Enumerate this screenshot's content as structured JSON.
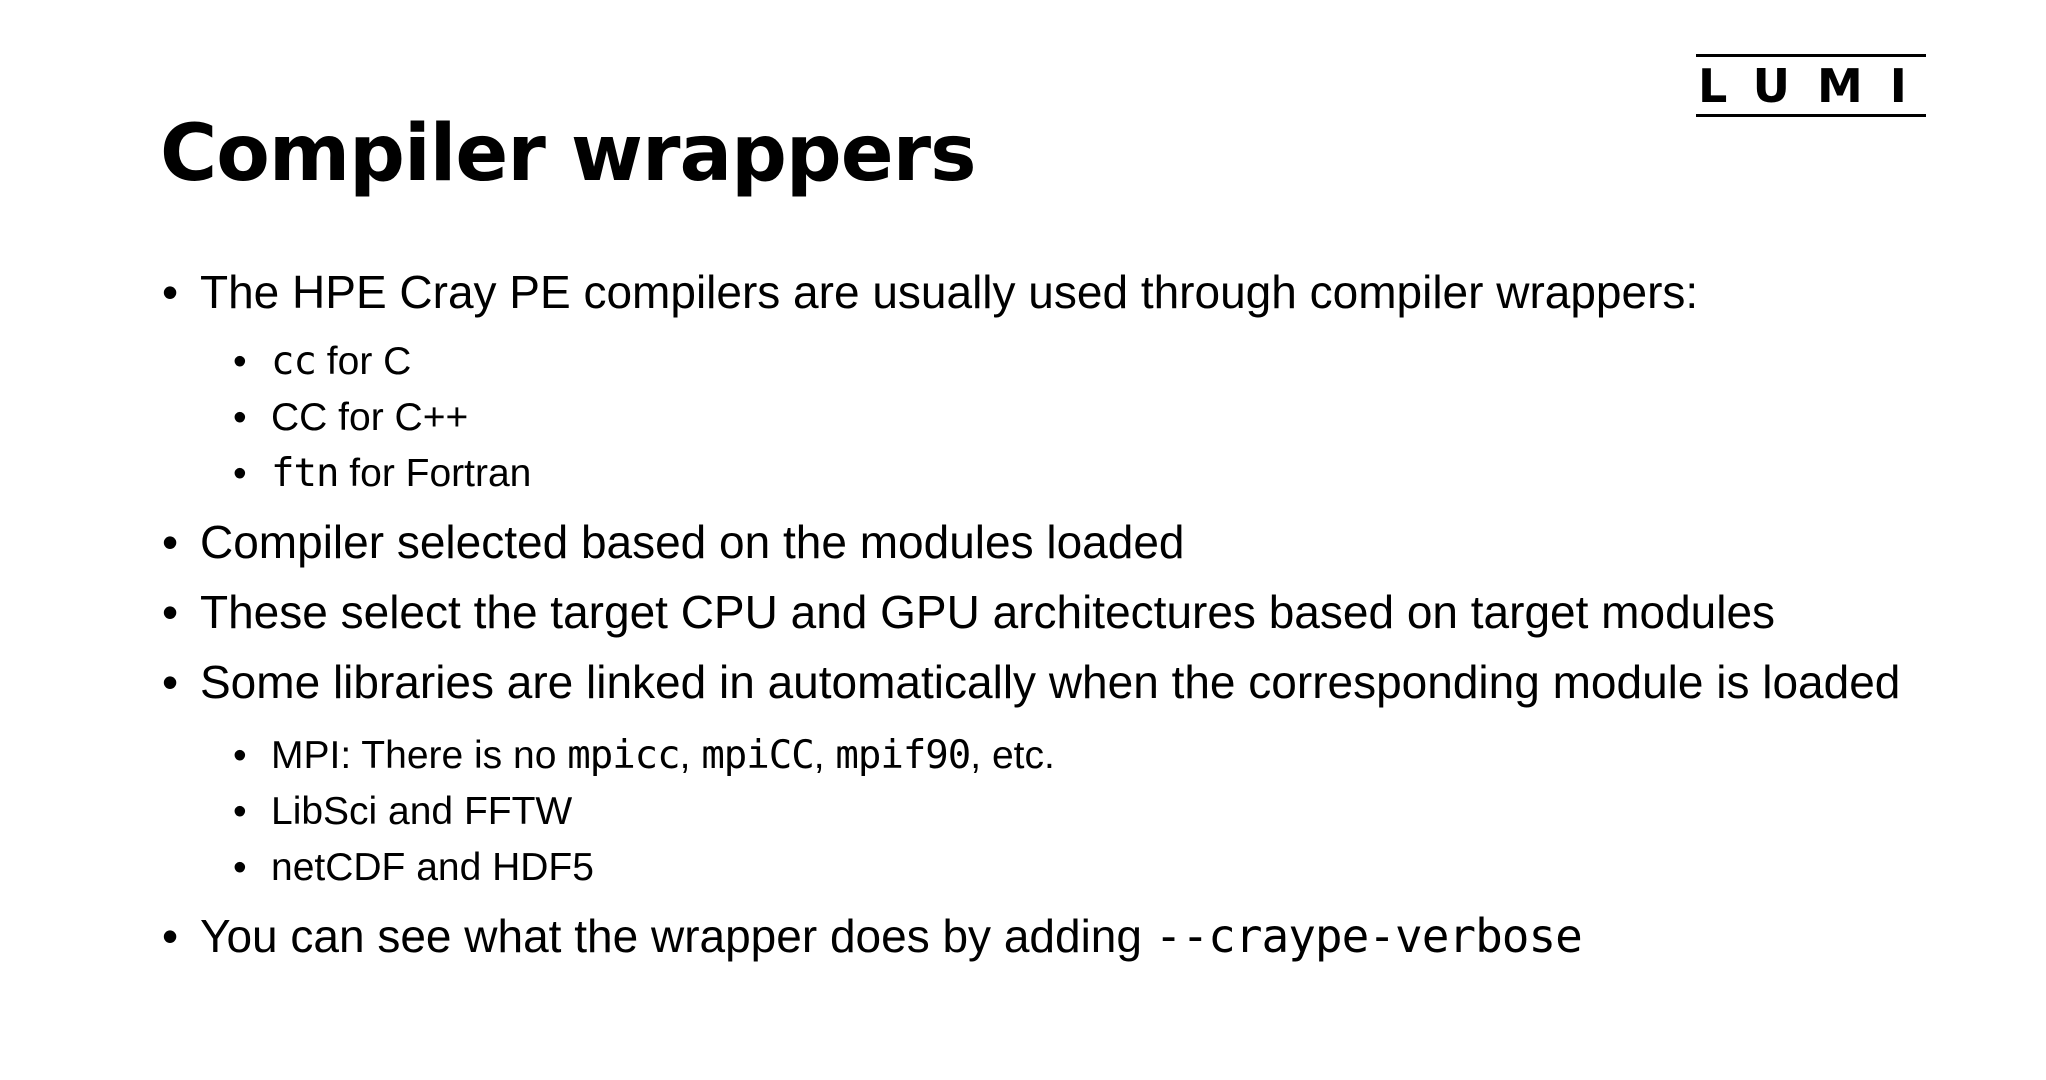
{
  "logo": {
    "text": "LUMI"
  },
  "slide": {
    "title": "Compiler wrappers"
  },
  "content": {
    "bullet_1": "The HPE Cray PE compilers are usually used through compiler wrappers:",
    "sub_1": {
      "code": "cc",
      "text": " for C"
    },
    "sub_2": {
      "code": "CC",
      "text": " for C++"
    },
    "sub_3": {
      "code": "ftn",
      "text": " for Fortran"
    },
    "bullet_2": "Compiler selected based on the modules loaded",
    "bullet_3": "These select the target CPU and GPU architectures based on target modules",
    "bullet_4": "Some libraries are linked in automatically when the corresponding module is loaded",
    "mpi": {
      "prefix": "MPI: There is no ",
      "code_1": "mpicc",
      "sep_1": ", ",
      "code_2": "mpiCC",
      "sep_2": ", ",
      "code_3": "mpif90",
      "suffix": ", etc."
    },
    "libsci": "LibSci and FFTW",
    "netcdf": "netCDF and HDF5",
    "bullet_5": {
      "text": "You can see what the wrapper does by adding ",
      "code": "--craype-verbose"
    }
  }
}
